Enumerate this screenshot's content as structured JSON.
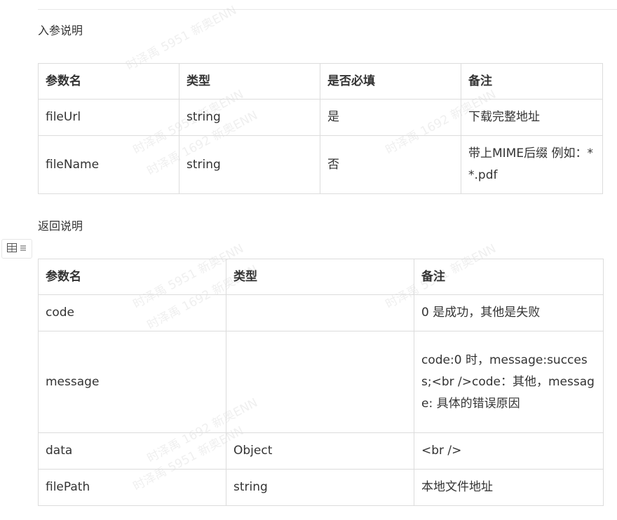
{
  "input_section": {
    "title": "入参说明",
    "headers": [
      "参数名",
      "类型",
      "是否必填",
      "备注"
    ],
    "rows": [
      [
        "fileUrl",
        "string",
        "是",
        "下载完整地址"
      ],
      [
        "fileName",
        "string",
        "否",
        "带上MIME后缀 例如：**.pdf"
      ]
    ]
  },
  "output_section": {
    "title": "返回说明",
    "headers": [
      "参数名",
      "类型",
      "备注"
    ],
    "rows": [
      [
        "code",
        "",
        "0 是成功，其他是失败"
      ],
      [
        "message",
        "",
        "code:0 时，message:success;<br />code：其他，message: 具体的错误原因"
      ],
      [
        "data",
        "Object",
        "<br />"
      ],
      [
        "filePath",
        "string",
        "本地文件地址"
      ]
    ]
  },
  "table_tool": {
    "grid_icon": "table-grid-icon",
    "menu_icon": "menu-lines-icon"
  },
  "watermark": {
    "line1": "时泽禹 5951 新奥ENN",
    "line2": "时泽禹 1692 新奥ENN"
  }
}
